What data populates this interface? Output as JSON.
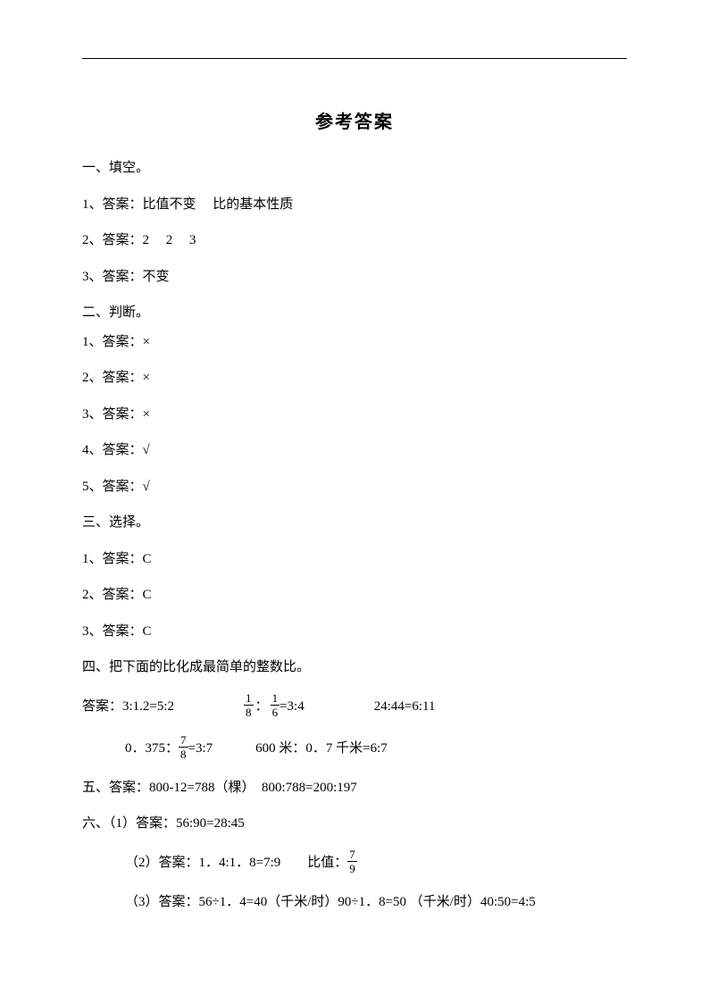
{
  "title": "参考答案",
  "section1": {
    "header": "一、填空。",
    "items": [
      "1、答案：比值不变　 比的基本性质",
      "2、答案：2　 2　 3",
      "3、答案：不变"
    ]
  },
  "section2": {
    "header": "二、判断。",
    "items": [
      "1、答案：×",
      "2、答案：×",
      "3、答案：×",
      "4、答案：√",
      "5、答案：√"
    ]
  },
  "section3": {
    "header": "三、选择。",
    "items": [
      "1、答案：C",
      "2、答案：C",
      "3、答案：C"
    ]
  },
  "section4": {
    "header": "四、把下面的比化成最简单的整数比。",
    "row1": {
      "p1": "答案：3:1.2=5:2",
      "frac1_num": "1",
      "frac1_den": "8",
      "colon": "：",
      "frac2_num": "1",
      "frac2_den": "6",
      "p2": "=3:4",
      "p3": "24:44=6:11"
    },
    "row2": {
      "p1": "0．375：",
      "frac_num": "7",
      "frac_den": "8",
      "p2": "=3:7",
      "p3": "600 米：0．7 千米=6:7"
    }
  },
  "section5": {
    "text": "五、答案：800-12=788（棵）　800:788=200:197"
  },
  "section6": {
    "line1": "六、（1）答案：56:90=28:45",
    "line2": {
      "p1": "（2）答案：1．4:1．8=7:9　　比值：",
      "frac_num": "7",
      "frac_den": "9"
    },
    "line3": "（3）答案：56÷1．4=40（千米/时）90÷1．8=50 （千米/时）40:50=4:5"
  }
}
